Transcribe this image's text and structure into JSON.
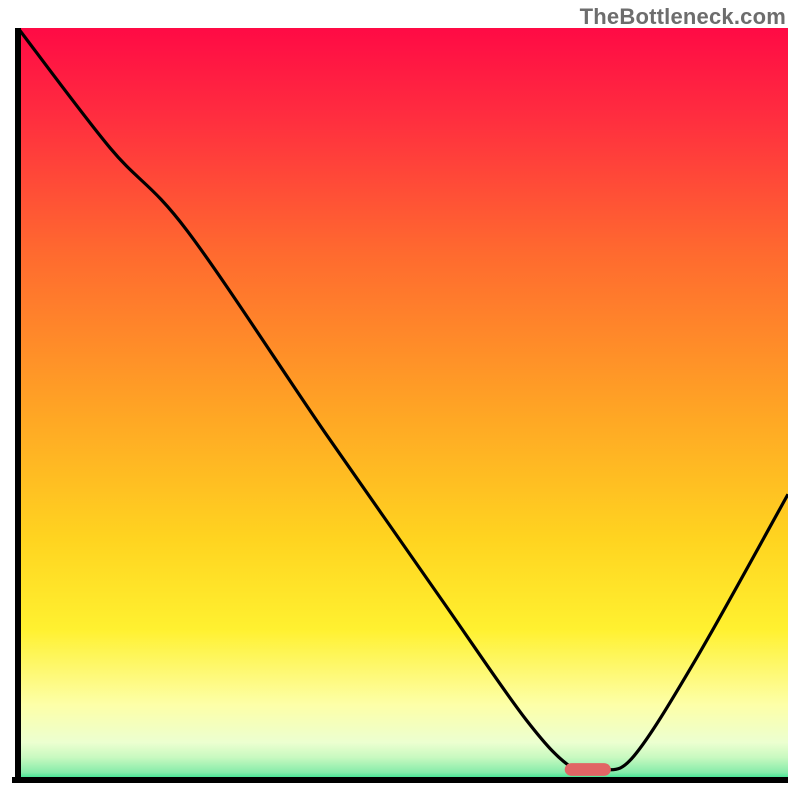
{
  "watermark": "TheBottleneck.com",
  "chart_data": {
    "type": "line",
    "title": "",
    "xlabel": "",
    "ylabel": "",
    "xlim": [
      0,
      100
    ],
    "ylim": [
      0,
      100
    ],
    "curve": [
      {
        "x": 0,
        "y": 100
      },
      {
        "x": 12,
        "y": 84
      },
      {
        "x": 22,
        "y": 73
      },
      {
        "x": 40,
        "y": 46
      },
      {
        "x": 55,
        "y": 24
      },
      {
        "x": 66,
        "y": 8
      },
      {
        "x": 72,
        "y": 1.6
      },
      {
        "x": 76,
        "y": 1.3
      },
      {
        "x": 80,
        "y": 3.2
      },
      {
        "x": 88,
        "y": 16
      },
      {
        "x": 100,
        "y": 38
      }
    ],
    "marker": {
      "x_center": 74,
      "y_center": 1.4,
      "width_pct": 6,
      "height_pct": 1.7
    },
    "gradient": [
      {
        "stop": 0.0,
        "color": "#ff0a45"
      },
      {
        "stop": 0.5,
        "color": "#ffa225"
      },
      {
        "stop": 0.8,
        "color": "#fff130"
      },
      {
        "stop": 1.0,
        "color": "#22e38a"
      }
    ]
  }
}
